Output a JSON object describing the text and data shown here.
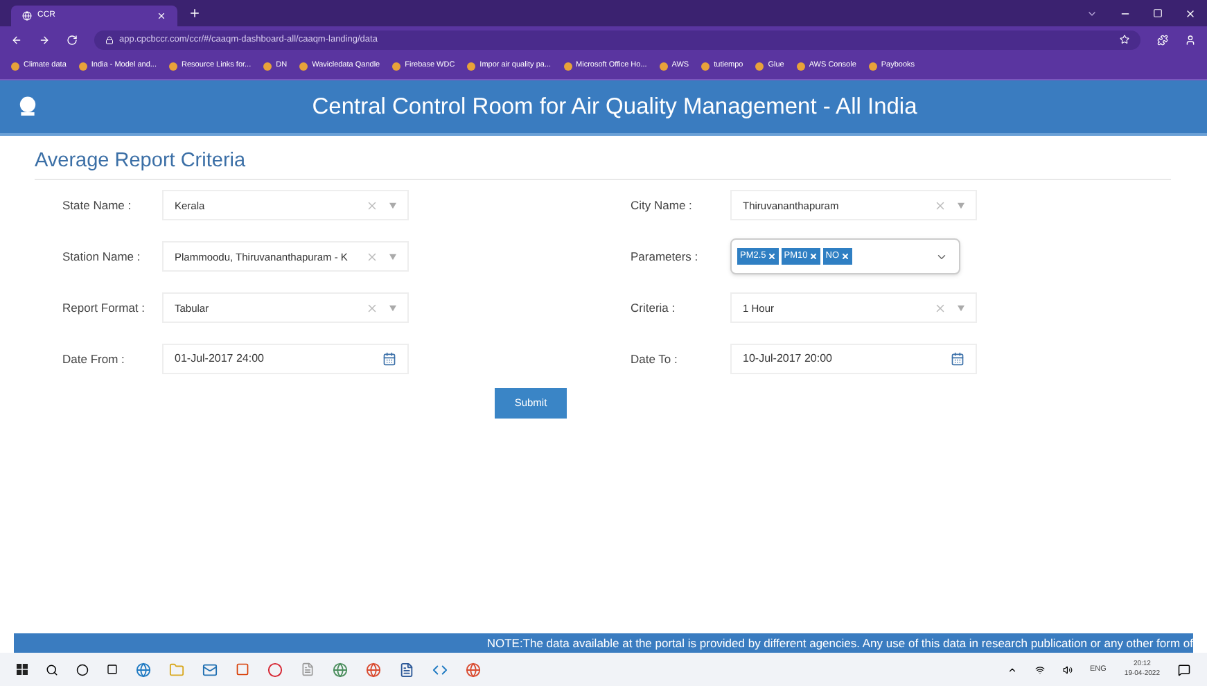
{
  "browser": {
    "tab_title": "CCR",
    "url": "app.cpcbccr.com/ccr/#/caaqm-dashboard-all/caaqm-landing/data",
    "bookmarks": [
      "Climate data",
      "India - Model and...",
      "Resource Links for...",
      "DN",
      "Wavicledata Qandle",
      "Firebase WDC",
      "Impor air quality pa...",
      "Microsoft Office Ho...",
      "AWS",
      "tutiempo",
      "Glue",
      "AWS Console",
      "Paybooks"
    ]
  },
  "header": {
    "title": "Central Control Room for Air Quality Management - All India"
  },
  "form": {
    "heading": "Average Report Criteria",
    "fields": [
      {
        "kind": "select",
        "label": "State Name :",
        "value": "Kerala"
      },
      {
        "kind": "select",
        "label": "City Name :",
        "value": "Thiruvananthapuram"
      },
      {
        "kind": "select",
        "label": "Station Name :",
        "value": "Plammoodu, Thiruvananthapuram - K"
      },
      {
        "kind": "multiselect",
        "label": "Parameters :",
        "chips": [
          "PM2.5",
          "PM10",
          "NO"
        ]
      },
      {
        "kind": "select",
        "label": "Report Format :",
        "value": "Tabular"
      },
      {
        "kind": "select",
        "label": "Criteria :",
        "value": "1 Hour"
      },
      {
        "kind": "date",
        "label": "Date From :",
        "value": "01-Jul-2017 24:00"
      },
      {
        "kind": "date",
        "label": "Date To :",
        "value": "10-Jul-2017 20:00"
      }
    ],
    "submit": "Submit"
  },
  "note": "NOTE:The data available at the portal is provided by different agencies. Any use of this data in research publication or any other form of",
  "taskbar": {
    "language": "ENG",
    "time": "20:12",
    "date": "19-04-2022"
  }
}
